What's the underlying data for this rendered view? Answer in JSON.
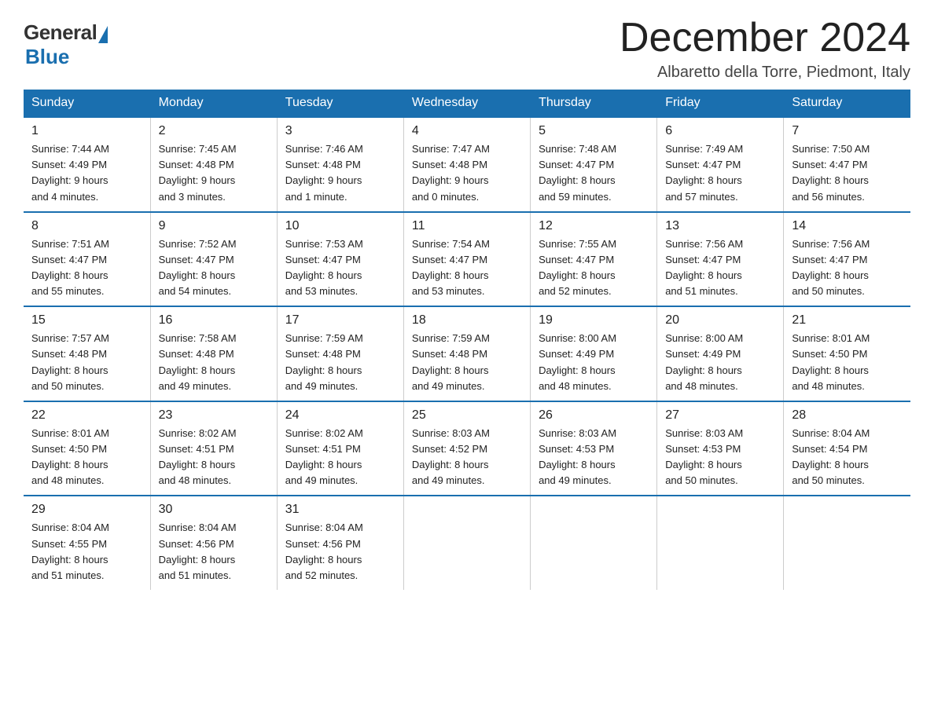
{
  "logo": {
    "general": "General",
    "blue": "Blue"
  },
  "title": "December 2024",
  "location": "Albaretto della Torre, Piedmont, Italy",
  "days_of_week": [
    "Sunday",
    "Monday",
    "Tuesday",
    "Wednesday",
    "Thursday",
    "Friday",
    "Saturday"
  ],
  "weeks": [
    [
      {
        "day": "1",
        "info": "Sunrise: 7:44 AM\nSunset: 4:49 PM\nDaylight: 9 hours\nand 4 minutes."
      },
      {
        "day": "2",
        "info": "Sunrise: 7:45 AM\nSunset: 4:48 PM\nDaylight: 9 hours\nand 3 minutes."
      },
      {
        "day": "3",
        "info": "Sunrise: 7:46 AM\nSunset: 4:48 PM\nDaylight: 9 hours\nand 1 minute."
      },
      {
        "day": "4",
        "info": "Sunrise: 7:47 AM\nSunset: 4:48 PM\nDaylight: 9 hours\nand 0 minutes."
      },
      {
        "day": "5",
        "info": "Sunrise: 7:48 AM\nSunset: 4:47 PM\nDaylight: 8 hours\nand 59 minutes."
      },
      {
        "day": "6",
        "info": "Sunrise: 7:49 AM\nSunset: 4:47 PM\nDaylight: 8 hours\nand 57 minutes."
      },
      {
        "day": "7",
        "info": "Sunrise: 7:50 AM\nSunset: 4:47 PM\nDaylight: 8 hours\nand 56 minutes."
      }
    ],
    [
      {
        "day": "8",
        "info": "Sunrise: 7:51 AM\nSunset: 4:47 PM\nDaylight: 8 hours\nand 55 minutes."
      },
      {
        "day": "9",
        "info": "Sunrise: 7:52 AM\nSunset: 4:47 PM\nDaylight: 8 hours\nand 54 minutes."
      },
      {
        "day": "10",
        "info": "Sunrise: 7:53 AM\nSunset: 4:47 PM\nDaylight: 8 hours\nand 53 minutes."
      },
      {
        "day": "11",
        "info": "Sunrise: 7:54 AM\nSunset: 4:47 PM\nDaylight: 8 hours\nand 53 minutes."
      },
      {
        "day": "12",
        "info": "Sunrise: 7:55 AM\nSunset: 4:47 PM\nDaylight: 8 hours\nand 52 minutes."
      },
      {
        "day": "13",
        "info": "Sunrise: 7:56 AM\nSunset: 4:47 PM\nDaylight: 8 hours\nand 51 minutes."
      },
      {
        "day": "14",
        "info": "Sunrise: 7:56 AM\nSunset: 4:47 PM\nDaylight: 8 hours\nand 50 minutes."
      }
    ],
    [
      {
        "day": "15",
        "info": "Sunrise: 7:57 AM\nSunset: 4:48 PM\nDaylight: 8 hours\nand 50 minutes."
      },
      {
        "day": "16",
        "info": "Sunrise: 7:58 AM\nSunset: 4:48 PM\nDaylight: 8 hours\nand 49 minutes."
      },
      {
        "day": "17",
        "info": "Sunrise: 7:59 AM\nSunset: 4:48 PM\nDaylight: 8 hours\nand 49 minutes."
      },
      {
        "day": "18",
        "info": "Sunrise: 7:59 AM\nSunset: 4:48 PM\nDaylight: 8 hours\nand 49 minutes."
      },
      {
        "day": "19",
        "info": "Sunrise: 8:00 AM\nSunset: 4:49 PM\nDaylight: 8 hours\nand 48 minutes."
      },
      {
        "day": "20",
        "info": "Sunrise: 8:00 AM\nSunset: 4:49 PM\nDaylight: 8 hours\nand 48 minutes."
      },
      {
        "day": "21",
        "info": "Sunrise: 8:01 AM\nSunset: 4:50 PM\nDaylight: 8 hours\nand 48 minutes."
      }
    ],
    [
      {
        "day": "22",
        "info": "Sunrise: 8:01 AM\nSunset: 4:50 PM\nDaylight: 8 hours\nand 48 minutes."
      },
      {
        "day": "23",
        "info": "Sunrise: 8:02 AM\nSunset: 4:51 PM\nDaylight: 8 hours\nand 48 minutes."
      },
      {
        "day": "24",
        "info": "Sunrise: 8:02 AM\nSunset: 4:51 PM\nDaylight: 8 hours\nand 49 minutes."
      },
      {
        "day": "25",
        "info": "Sunrise: 8:03 AM\nSunset: 4:52 PM\nDaylight: 8 hours\nand 49 minutes."
      },
      {
        "day": "26",
        "info": "Sunrise: 8:03 AM\nSunset: 4:53 PM\nDaylight: 8 hours\nand 49 minutes."
      },
      {
        "day": "27",
        "info": "Sunrise: 8:03 AM\nSunset: 4:53 PM\nDaylight: 8 hours\nand 50 minutes."
      },
      {
        "day": "28",
        "info": "Sunrise: 8:04 AM\nSunset: 4:54 PM\nDaylight: 8 hours\nand 50 minutes."
      }
    ],
    [
      {
        "day": "29",
        "info": "Sunrise: 8:04 AM\nSunset: 4:55 PM\nDaylight: 8 hours\nand 51 minutes."
      },
      {
        "day": "30",
        "info": "Sunrise: 8:04 AM\nSunset: 4:56 PM\nDaylight: 8 hours\nand 51 minutes."
      },
      {
        "day": "31",
        "info": "Sunrise: 8:04 AM\nSunset: 4:56 PM\nDaylight: 8 hours\nand 52 minutes."
      },
      {
        "day": "",
        "info": ""
      },
      {
        "day": "",
        "info": ""
      },
      {
        "day": "",
        "info": ""
      },
      {
        "day": "",
        "info": ""
      }
    ]
  ]
}
